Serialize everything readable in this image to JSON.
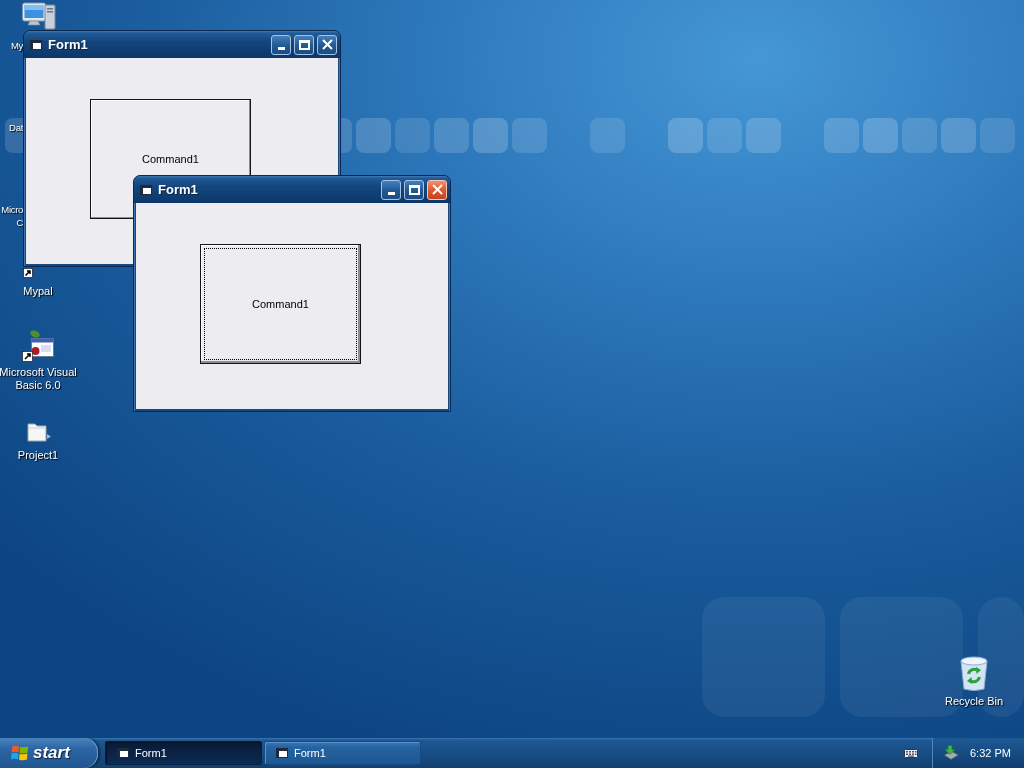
{
  "desktop_icons": [
    {
      "kind": "computer",
      "shortcut": false,
      "label_lines": [
        "My"
      ]
    },
    {
      "kind": "hidden",
      "shortcut": false,
      "label_lines": [
        "Dat"
      ]
    },
    {
      "kind": "hidden",
      "shortcut": false,
      "label_lines": [
        "Micro",
        "C"
      ]
    },
    {
      "kind": "hidden",
      "shortcut": true,
      "label_lines": [
        "Mypal"
      ]
    },
    {
      "kind": "program",
      "shortcut": true,
      "label_lines": [
        "Microsoft Visual",
        "Basic 6.0"
      ]
    },
    {
      "kind": "folder",
      "shortcut": false,
      "label_lines": [
        "Project1"
      ]
    },
    {
      "kind": "recycle-bin",
      "shortcut": false,
      "label_lines": [
        "Recycle Bin"
      ]
    }
  ],
  "windows": [
    {
      "title": "Form1",
      "active": false,
      "command_button": {
        "label": "Command1",
        "focused": false
      }
    },
    {
      "title": "Form1",
      "active": true,
      "command_button": {
        "label": "Command1",
        "focused": true
      }
    }
  ],
  "taskbar": {
    "start_label": "start",
    "tasks": [
      {
        "label": "Form1",
        "selected": true
      },
      {
        "label": "Form1",
        "selected": false
      }
    ],
    "clock": "6:32 PM"
  }
}
